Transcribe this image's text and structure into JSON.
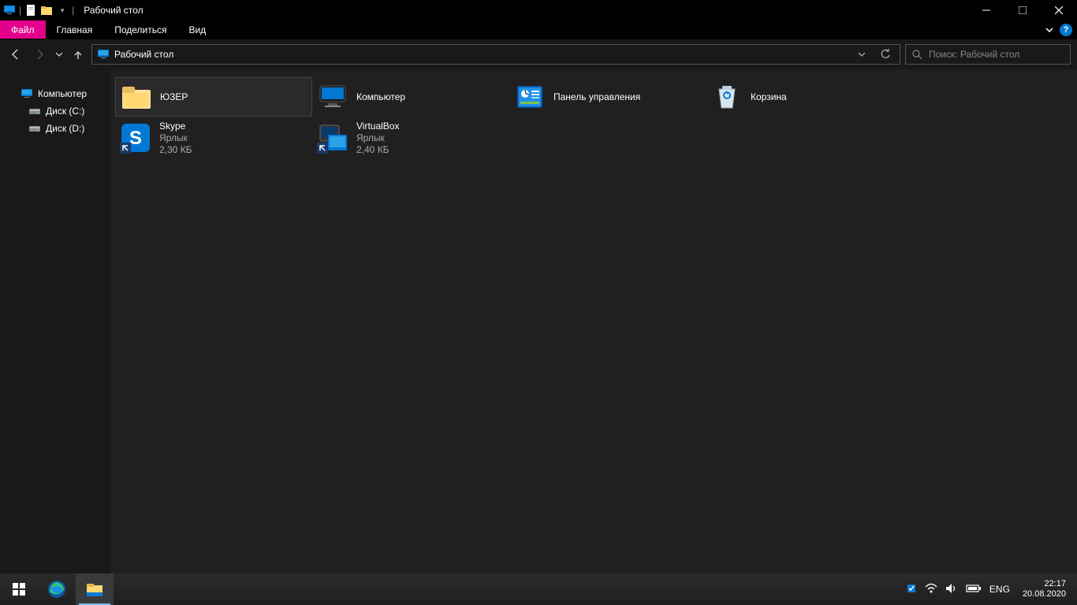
{
  "titlebar": {
    "title": "Рабочий стол"
  },
  "ribbon": {
    "file": "Файл",
    "home": "Главная",
    "share": "Поделиться",
    "view": "Вид"
  },
  "address": {
    "path": "Рабочий стол"
  },
  "search": {
    "placeholder": "Поиск: Рабочий стол"
  },
  "sidebar": {
    "computer": "Компьютер",
    "disk_c": "Диск (C:)",
    "disk_d": "Диск (D:)"
  },
  "items": [
    {
      "name": "ЮЗЕР",
      "line2": "",
      "line3": ""
    },
    {
      "name": "Компьютер",
      "line2": "",
      "line3": ""
    },
    {
      "name": "Панель управления",
      "line2": "",
      "line3": ""
    },
    {
      "name": "Корзина",
      "line2": "",
      "line3": ""
    },
    {
      "name": "Skype",
      "line2": "Ярлык",
      "line3": "2,30 КБ"
    },
    {
      "name": "VirtualBox",
      "line2": "Ярлык",
      "line3": "2,40 КБ"
    }
  ],
  "taskbar": {
    "lang": "ENG",
    "time": "22:17",
    "date": "20.08.2020"
  }
}
